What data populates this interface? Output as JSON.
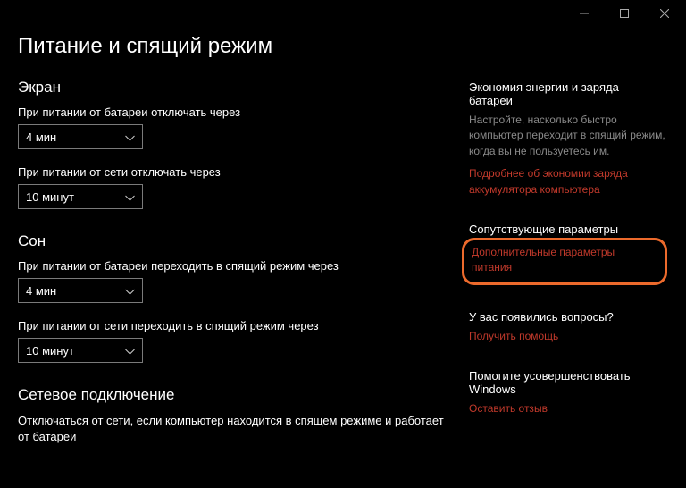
{
  "page_title": "Питание и спящий режим",
  "screen": {
    "heading": "Экран",
    "battery_off_label": "При питании от батареи отключать через",
    "battery_off_value": "4 мин",
    "ac_off_label": "При питании от сети отключать через",
    "ac_off_value": "10 минут"
  },
  "sleep": {
    "heading": "Сон",
    "battery_sleep_label": "При питании от батареи переходить в спящий режим через",
    "battery_sleep_value": "4 мин",
    "ac_sleep_label": "При питании от сети переходить в спящий режим через",
    "ac_sleep_value": "10 минут"
  },
  "network": {
    "heading": "Сетевое подключение",
    "desc": "Отключаться от сети, если компьютер находится в спящем режиме и работает от батареи"
  },
  "sidebar": {
    "energy": {
      "title": "Экономия энергии и заряда батареи",
      "desc": "Настройте, насколько быстро компьютер переходит в спящий режим, когда вы не пользуетесь им.",
      "link": "Подробнее об экономии заряда аккумулятора компьютера"
    },
    "related": {
      "title": "Сопутствующие параметры",
      "link": "Дополнительные параметры питания"
    },
    "questions": {
      "title": "У вас появились вопросы?",
      "link": "Получить помощь"
    },
    "improve": {
      "title": "Помогите усовершенствовать Windows",
      "link": "Оставить отзыв"
    }
  }
}
